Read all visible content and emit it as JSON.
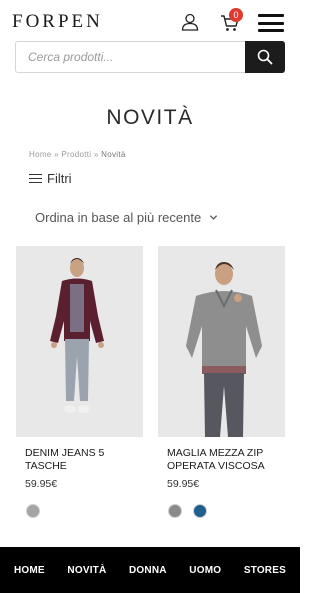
{
  "header": {
    "logo": "FORPEN",
    "cart_count": "0"
  },
  "search": {
    "placeholder": "Cerca prodotti..."
  },
  "page": {
    "title": "NOVITÀ"
  },
  "breadcrumb": {
    "items": [
      "Home",
      "Prodotti",
      "Novità"
    ],
    "separator": "»"
  },
  "filters": {
    "label": "Filtri"
  },
  "sort": {
    "label": "Ordina in base al più recente"
  },
  "products": [
    {
      "name": "DENIM JEANS 5 TASCHE",
      "price": "59.95€",
      "swatches": [
        "#a5a5a5"
      ]
    },
    {
      "name": "MAGLIA MEZZA ZIP OPERATA VISCOSA",
      "price": "59.95€",
      "swatches": [
        "#8a8a8a",
        "#1f5f8e"
      ]
    }
  ],
  "bottom_nav": {
    "items": [
      "HOME",
      "NOVITÀ",
      "DONNA",
      "UOMO",
      "STORES"
    ]
  },
  "colors": {
    "accent_badge": "#e03a2f",
    "nav_background": "#000000",
    "search_button": "#1c1c1c"
  }
}
